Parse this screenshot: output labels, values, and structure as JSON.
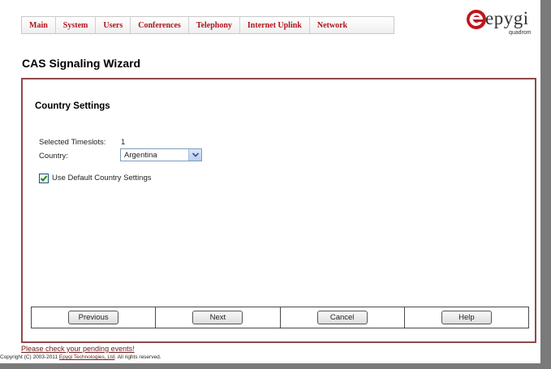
{
  "nav": {
    "items": [
      "Main",
      "System",
      "Users",
      "Conferences",
      "Telephony",
      "Internet Uplink",
      "Network"
    ]
  },
  "logo": {
    "wordmark": "epygi",
    "sub": "quadrom"
  },
  "page": {
    "title": "CAS Signaling Wizard"
  },
  "section": {
    "title": "Country Settings"
  },
  "form": {
    "timeslots_label": "Selected Timeslots:",
    "timeslots_value": "1",
    "country_label": "Country:",
    "country_value": "Argentina",
    "use_default_label": "Use Default Country Settings",
    "use_default_checked": true
  },
  "buttons": {
    "previous": "Previous",
    "next": "Next",
    "cancel": "Cancel",
    "help": "Help"
  },
  "footer": {
    "pending_link": "Please check your pending events!",
    "copyright_prefix": "Copyright (C) 2003-2011 ",
    "copyright_link": "Epygi Technologies, Ltd",
    "copyright_suffix": ". All rights reserved."
  },
  "colors": {
    "nav_text": "#b0121a",
    "panel_border": "#8e4a4a",
    "link": "#6b1a1a"
  }
}
